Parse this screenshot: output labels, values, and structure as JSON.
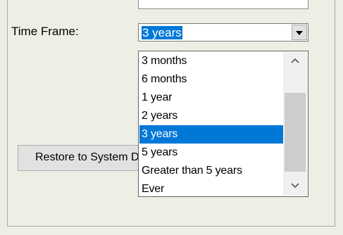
{
  "time_frame": {
    "label": "Time Frame:",
    "selected_value": "3 years",
    "options": [
      "3 months",
      "6 months",
      "1 year",
      "2 years",
      "3 years",
      "5 years",
      "Greater than 5 years",
      "Ever"
    ],
    "selected_index": 4
  },
  "restore_button": {
    "label": "Restore to System Defaults"
  },
  "colors": {
    "selection": "#0078d7",
    "window_background": "#eeefe4",
    "scrollbar_thumb": "#cdcdcd"
  },
  "icons": {
    "combo_dropdown": "chevron-down-icon",
    "scroll_up": "scroll-up-arrow-icon",
    "scroll_down": "scroll-down-arrow-icon"
  }
}
